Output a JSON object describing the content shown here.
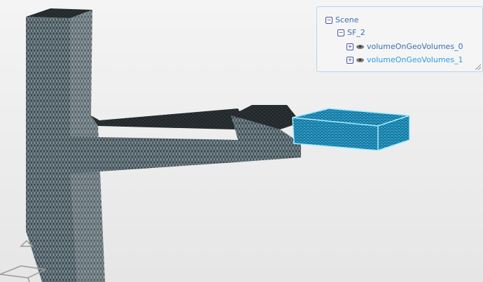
{
  "scene_tree": {
    "root": "Scene",
    "child": "SF_2",
    "items": [
      {
        "label": "volumeOnGeoVolumes_0",
        "highlighted": false
      },
      {
        "label": "volumeOnGeoVolumes_1",
        "highlighted": true
      }
    ]
  },
  "colors": {
    "mesh": "#6e8088",
    "selected": "#29a9d8",
    "selection_edge": "#9be6ff"
  }
}
